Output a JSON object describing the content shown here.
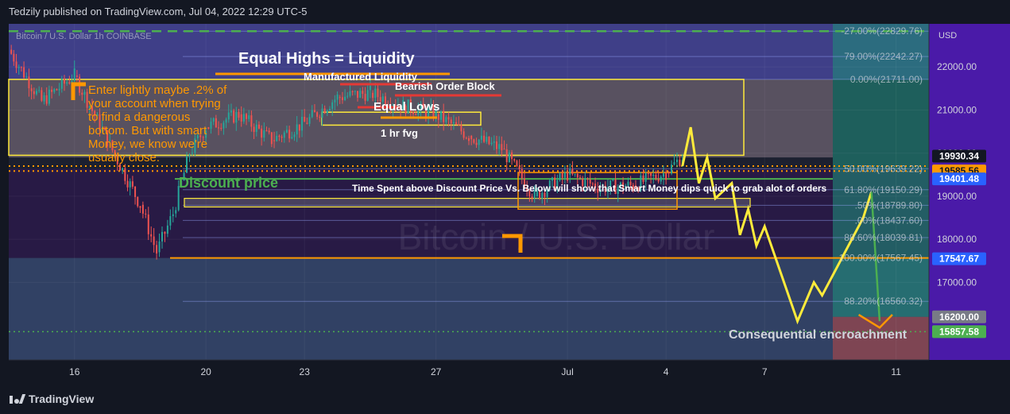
{
  "header": {
    "published": "Tedzily published on TradingView.com, Jul 04, 2022 12:29 UTC-5"
  },
  "footer": {
    "brand": "TradingView"
  },
  "chart_data": {
    "type": "candlestick",
    "symbol_line": "Bitcoin / U.S. Dollar 1h COINBASE",
    "watermark": "Bitcoin / U.S. Dollar",
    "currency": "USD",
    "ylim": [
      15200,
      23000
    ],
    "y_ticks": [
      17000,
      18000,
      19000,
      20000,
      21000,
      22000
    ],
    "y_tick_labels": [
      "17000.00",
      "18000.00",
      "19000.00",
      "20000.00",
      "21000.00",
      "22000.00"
    ],
    "x_range_days": [
      "2022-06-14",
      "2022-07-12"
    ],
    "x_ticks": [
      {
        "date": "2022-06-16",
        "label": "16"
      },
      {
        "date": "2022-06-20",
        "label": "20"
      },
      {
        "date": "2022-06-23",
        "label": "23"
      },
      {
        "date": "2022-06-27",
        "label": "27"
      },
      {
        "date": "2022-07-01",
        "label": "Jul"
      },
      {
        "date": "2022-07-04",
        "label": "4"
      },
      {
        "date": "2022-07-07",
        "label": "7"
      },
      {
        "date": "2022-07-11",
        "label": "11"
      }
    ],
    "price_path": [
      [
        "2022-06-14",
        22400
      ],
      [
        "2022-06-15",
        21200
      ],
      [
        "2022-06-16",
        21800
      ],
      [
        "2022-06-17",
        20300
      ],
      [
        "2022-06-18",
        18800
      ],
      [
        "2022-06-18T12",
        17700
      ],
      [
        "2022-06-19",
        18600
      ],
      [
        "2022-06-19T12",
        20000
      ],
      [
        "2022-06-20",
        20600
      ],
      [
        "2022-06-21",
        20900
      ],
      [
        "2022-06-22",
        20300
      ],
      [
        "2022-06-23",
        20700
      ],
      [
        "2022-06-24",
        21300
      ],
      [
        "2022-06-25",
        21400
      ],
      [
        "2022-06-26",
        21100
      ],
      [
        "2022-06-27",
        20900
      ],
      [
        "2022-06-28",
        20400
      ],
      [
        "2022-06-29",
        20100
      ],
      [
        "2022-06-30",
        19000
      ],
      [
        "2022-07-01",
        19500
      ],
      [
        "2022-07-02",
        19200
      ],
      [
        "2022-07-03",
        19250
      ],
      [
        "2022-07-04",
        19550
      ],
      [
        "2022-07-04T12",
        19930
      ]
    ],
    "projection_path": [
      [
        "2022-07-04T12",
        19700
      ],
      [
        "2022-07-04T18",
        20600
      ],
      [
        "2022-07-05",
        19300
      ],
      [
        "2022-07-05T06",
        19900
      ],
      [
        "2022-07-05T12",
        18950
      ],
      [
        "2022-07-06",
        19300
      ],
      [
        "2022-07-06T06",
        18100
      ],
      [
        "2022-07-06T12",
        18700
      ],
      [
        "2022-07-06T18",
        17850
      ],
      [
        "2022-07-07",
        18300
      ],
      [
        "2022-07-08",
        16100
      ],
      [
        "2022-07-08T12",
        17000
      ],
      [
        "2022-07-08T18",
        16700
      ],
      [
        "2022-07-10",
        18500
      ],
      [
        "2022-07-10T06",
        19100
      ]
    ],
    "fib_levels": [
      {
        "label": "-27.00%(22829.76)",
        "value": 22829.76
      },
      {
        "label": "79.00%(22242.27)",
        "value": 22242.27
      },
      {
        "label": "0.00%(21711.00)",
        "value": 21711.0
      },
      {
        "label": "50.00%(19639.22)",
        "value": 19639.22
      },
      {
        "label": "61.80%(19150.29)",
        "value": 19150.29
      },
      {
        "label": ".50%(18789.80)",
        "value": 18789.8
      },
      {
        "label": ".00%(18437.60)",
        "value": 18437.6
      },
      {
        "label": "88.60%(18039.81)",
        "value": 18039.81
      },
      {
        "label": "100.00%(17567.45)",
        "value": 17567.45
      },
      {
        "label": "88.20%(16560.32)",
        "value": 16560.32
      }
    ],
    "price_badges": [
      {
        "label": "19930.34",
        "value": 19930.34,
        "color": "#131722",
        "text": "#ffffff"
      },
      {
        "label": "19585.56",
        "value": 19585.56,
        "color": "#ff9800",
        "text": "#131722"
      },
      {
        "label": "19401.48",
        "value": 19401.48,
        "color": "#2962ff",
        "text": "#ffffff"
      },
      {
        "label": "17547.67",
        "value": 17547.67,
        "color": "#2962ff",
        "text": "#ffffff"
      },
      {
        "label": "16200.00",
        "value": 16200.0,
        "color": "#787b86",
        "text": "#ffffff"
      },
      {
        "label": "15857.58",
        "value": 15857.58,
        "color": "#4caf50",
        "text": "#ffffff"
      }
    ],
    "annotations": {
      "equal_highs": "Equal Highs = Liquidity",
      "manufactured": "Manufactured Liquidity",
      "bearish_ob": "Bearish Order Block",
      "equal_lows": "Equal Lows",
      "fvg": "1 hr fvg",
      "discount": "Discount price",
      "time_spent": "Time Spent above Discount Price Vs. Below  will show that Smart Money dips quick to grab alot of orders",
      "consequential": "Consequential encroachment",
      "enter_lightly": [
        "Enter lightly maybe .2% of",
        "your account when trying",
        "to find a dangerous",
        "bottom. But with smart",
        "Money, we know we're",
        "usually close."
      ]
    },
    "colors": {
      "up": "#26a69a",
      "down": "#ef5350",
      "projection": "#ffeb3b",
      "annotation_orange": "#ff9800",
      "discount_green": "#4caf50"
    }
  }
}
